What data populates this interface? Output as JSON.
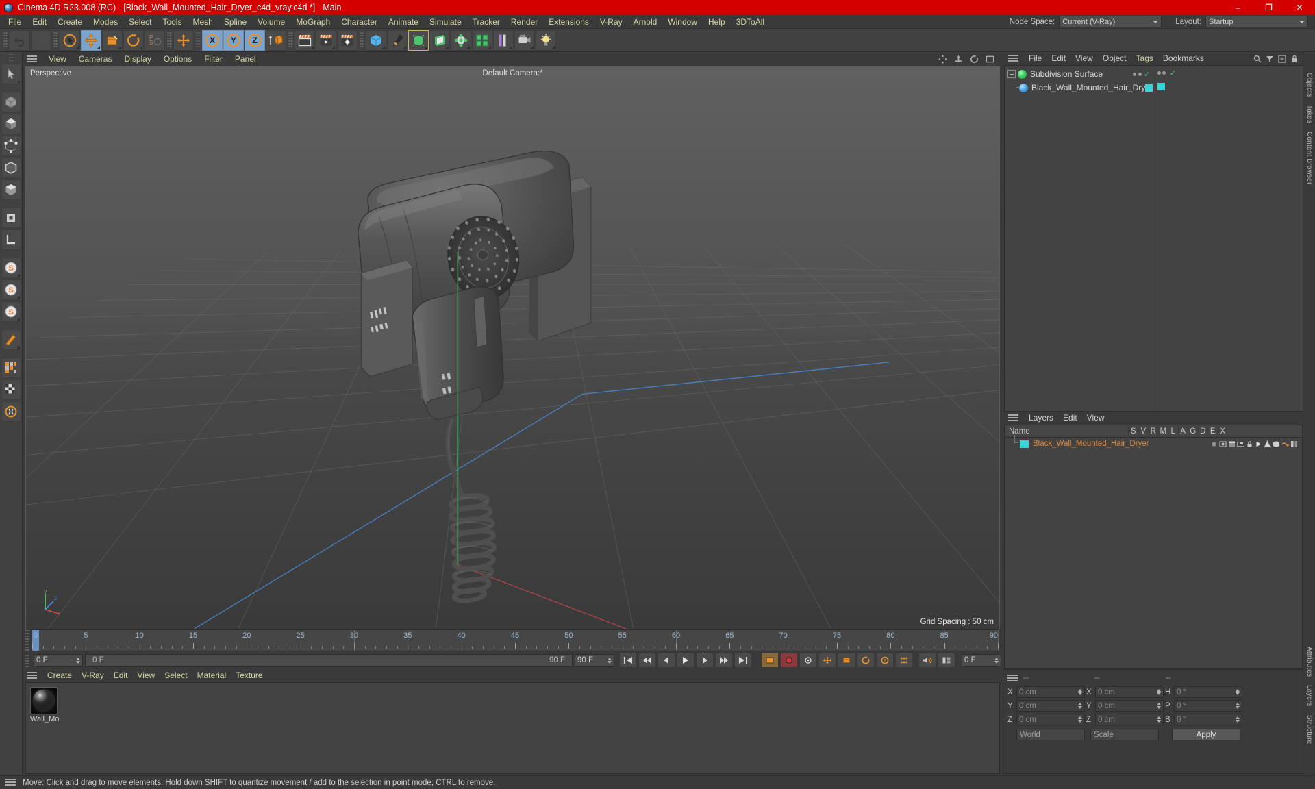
{
  "window": {
    "title": "Cinema 4D R23.008 (RC) - [Black_Wall_Mounted_Hair_Dryer_c4d_vray.c4d *] - Main",
    "minimize": "–",
    "maximize": "❐",
    "close": "✕"
  },
  "menubar": {
    "items": [
      "File",
      "Edit",
      "Create",
      "Modes",
      "Select",
      "Tools",
      "Mesh",
      "Spline",
      "Volume",
      "MoGraph",
      "Character",
      "Animate",
      "Simulate",
      "Tracker",
      "Render",
      "Extensions",
      "V-Ray",
      "Arnold",
      "Window",
      "Help",
      "3DToAll"
    ]
  },
  "node_space": {
    "label": "Node Space:",
    "value": "Current (V-Ray)"
  },
  "layout": {
    "label": "Layout:",
    "value": "Startup"
  },
  "toolbar": {
    "groups": [
      {
        "name": "history",
        "buttons": [
          {
            "name": "undo-button",
            "icon": "undo"
          },
          {
            "name": "redo-button",
            "icon": "redo"
          }
        ]
      },
      {
        "name": "transform",
        "buttons": [
          {
            "name": "select-tool-button",
            "icon": "cursor-circle"
          },
          {
            "name": "move-tool-button",
            "icon": "move",
            "active": true
          },
          {
            "name": "scale-tool-button",
            "icon": "scale"
          },
          {
            "name": "rotate-tool-button",
            "icon": "rotate"
          }
        ]
      },
      {
        "name": "psr",
        "buttons": [
          {
            "name": "psr-button",
            "icon": "psr"
          }
        ]
      },
      {
        "name": "world-axis",
        "buttons": [
          {
            "name": "world-axis-button",
            "icon": "move"
          }
        ]
      },
      {
        "name": "axis-locks",
        "buttons": [
          {
            "name": "x-axis-lock-button",
            "icon": "X",
            "active": true
          },
          {
            "name": "y-axis-lock-button",
            "icon": "Y",
            "active": true
          },
          {
            "name": "z-axis-lock-button",
            "icon": "Z",
            "active": true
          },
          {
            "name": "world-object-coord-button",
            "icon": "world-cube"
          }
        ]
      },
      {
        "name": "render",
        "buttons": [
          {
            "name": "render-view-button",
            "icon": "render-view"
          },
          {
            "name": "render-picture-viewer-button",
            "icon": "render-play"
          },
          {
            "name": "render-settings-button",
            "icon": "render-gear"
          }
        ]
      },
      {
        "name": "primitives",
        "buttons": [
          {
            "name": "cube-primitive-button",
            "icon": "cube-blue"
          },
          {
            "name": "pen-spline-button",
            "icon": "pen"
          },
          {
            "name": "subdivision-surface-button",
            "icon": "sds-green",
            "highlight": true
          },
          {
            "name": "array-generator-button",
            "icon": "extrude-green"
          },
          {
            "name": "deformer-button",
            "icon": "bend-green"
          },
          {
            "name": "mograph-cloner-button",
            "icon": "cloner-green"
          },
          {
            "name": "scene-nulls-button",
            "icon": "scene-purple"
          },
          {
            "name": "camera-button",
            "icon": "camera"
          },
          {
            "name": "lights-button",
            "icon": "light-bulb"
          }
        ]
      }
    ]
  },
  "left_palette": {
    "buttons": [
      {
        "name": "live-selection-tool",
        "icon": "cursor"
      },
      {
        "name": "model-mode-button",
        "icon": "cube-grey"
      },
      {
        "name": "texture-mode-button",
        "icon": "checker"
      },
      {
        "name": "points-mode-button",
        "icon": "points"
      },
      {
        "name": "edges-mode-button",
        "icon": "edges"
      },
      {
        "name": "polygons-mode-button",
        "icon": "polys"
      },
      {
        "name": "enable-axis-button",
        "icon": "axis-square"
      },
      {
        "name": "workplane-button",
        "icon": "workplane"
      },
      {
        "name": "selection-s1-button",
        "icon": "S"
      },
      {
        "name": "selection-s2-button",
        "icon": "S"
      },
      {
        "name": "selection-s3-button",
        "icon": "S"
      },
      {
        "name": "knife-tool-button",
        "icon": "knife"
      },
      {
        "name": "uv-tool-button",
        "icon": "uv-grid"
      },
      {
        "name": "texture-axis-button",
        "icon": "tex-axis"
      },
      {
        "name": "viewport-solo-button",
        "icon": "solo"
      }
    ]
  },
  "viewport": {
    "menu": [
      "View",
      "Cameras",
      "Display",
      "Options",
      "Filter",
      "Panel"
    ],
    "label_left": "Perspective",
    "label_center": "Default Camera:*",
    "grid_spacing": "Grid Spacing : 50 cm",
    "axis_labels": {
      "x": "X",
      "y": "Y",
      "z": "Z"
    }
  },
  "object_manager": {
    "menu": [
      "File",
      "Edit",
      "View",
      "Object",
      "Tags",
      "Bookmarks"
    ],
    "rows": [
      {
        "name": "Subdivision Surface",
        "icon": "sds-green",
        "depth": 0,
        "selected": false
      },
      {
        "name": "Black_Wall_Mounted_Hair_Dryer",
        "icon": "polygon-blue",
        "depth": 1,
        "selected": false
      }
    ]
  },
  "layer_manager": {
    "menu": [
      "Layers",
      "Edit",
      "View"
    ],
    "columns": [
      "Name",
      "S",
      "V",
      "R",
      "M",
      "L",
      "A",
      "G",
      "D",
      "E",
      "X"
    ],
    "rows": [
      {
        "name": "Black_Wall_Mounted_Hair_Dryer",
        "color": "#34d6d6"
      }
    ]
  },
  "vertical_tabs": [
    "Objects",
    "Takes",
    "Content Browser",
    "Attributes",
    "Layers",
    "Structure"
  ],
  "timeline": {
    "ticks": [
      0,
      5,
      10,
      15,
      20,
      25,
      30,
      35,
      40,
      45,
      50,
      55,
      60,
      65,
      70,
      75,
      80,
      85,
      90
    ],
    "current_frame_field": "0 F",
    "range_start": "0 F",
    "range_end": "90 F",
    "end_field": "90 F",
    "right_field": "0 F",
    "playhead_frame": 0,
    "transport": [
      {
        "name": "go-to-start-button",
        "icon": "skip-start"
      },
      {
        "name": "previous-keyframe-button",
        "icon": "prev-key"
      },
      {
        "name": "step-back-button",
        "icon": "step-back"
      },
      {
        "name": "play-button",
        "icon": "play"
      },
      {
        "name": "step-forward-button",
        "icon": "step-fwd"
      },
      {
        "name": "next-keyframe-button",
        "icon": "next-key"
      },
      {
        "name": "go-to-end-button",
        "icon": "skip-end"
      }
    ],
    "record_controls": [
      {
        "name": "record-active-objects-button",
        "icon": "record-frame"
      },
      {
        "name": "autokeying-button",
        "icon": "record-dot"
      },
      {
        "name": "keyframe-selection-button",
        "icon": "key-select"
      },
      {
        "name": "position-key-button",
        "icon": "pos-key"
      },
      {
        "name": "scale-key-button",
        "icon": "scale-key"
      },
      {
        "name": "rotation-key-button",
        "icon": "rot-key"
      },
      {
        "name": "param-key-button",
        "icon": "param-key"
      },
      {
        "name": "pla-key-button",
        "icon": "pla-key"
      },
      {
        "name": "point-level-anim-button",
        "icon": "point-anim"
      },
      {
        "name": "sound-button",
        "icon": "speaker"
      },
      {
        "name": "timeline-layout-button",
        "icon": "layout-split"
      }
    ]
  },
  "material_manager": {
    "menu": [
      "Create",
      "V-Ray",
      "Edit",
      "View",
      "Select",
      "Material",
      "Texture"
    ],
    "materials": [
      {
        "name": "Wall_Mo"
      }
    ]
  },
  "coordinates": {
    "headers": [
      "--",
      "--",
      "--"
    ],
    "rows": [
      {
        "pos_label": "X",
        "pos_value": "0 cm",
        "size_label": "X",
        "size_value": "0 cm",
        "rot_label": "H",
        "rot_value": "0 °"
      },
      {
        "pos_label": "Y",
        "pos_value": "0 cm",
        "size_label": "Y",
        "size_value": "0 cm",
        "rot_label": "P",
        "rot_value": "0 °"
      },
      {
        "pos_label": "Z",
        "pos_value": "0 cm",
        "size_label": "Z",
        "size_value": "0 cm",
        "rot_label": "B",
        "rot_value": "0 °"
      }
    ],
    "system": "World",
    "mode": "Scale",
    "apply": "Apply"
  },
  "status_bar": {
    "message": "Move: Click and drag to move elements. Hold down SHIFT to quantize movement / add to the selection in point mode, CTRL to remove."
  },
  "colors": {
    "title_bar": "#d40000",
    "accent_orange": "#e08a3c",
    "menu_text": "#d7d7a8",
    "active_blue": "#7ba3cc",
    "layer_swatch": "#34d6d6"
  }
}
